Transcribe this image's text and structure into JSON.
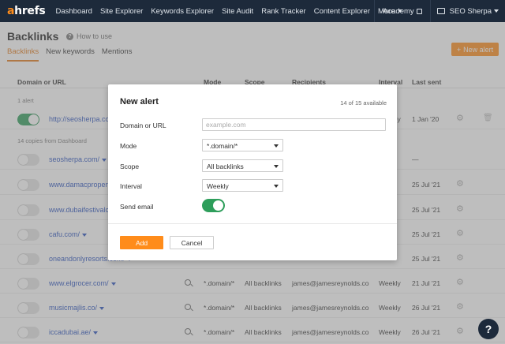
{
  "nav": {
    "logo_a": "a",
    "logo_rest": "hrefs",
    "items": [
      "Dashboard",
      "Site Explorer",
      "Keywords Explorer",
      "Site Audit",
      "Rank Tracker",
      "Content Explorer",
      "More"
    ],
    "academy": "Academy",
    "account": "SEO Sherpa"
  },
  "header": {
    "title": "Backlinks",
    "howto": "How to use",
    "tabs": [
      "Backlinks",
      "New keywords",
      "Mentions"
    ],
    "new_alert_button": "New alert"
  },
  "table": {
    "columns": {
      "domain": "Domain or URL",
      "mode": "Mode",
      "scope": "Scope",
      "recipients": "Recipients",
      "interval": "Interval",
      "last_sent": "Last sent"
    },
    "section1": "1 alert",
    "section2": "14 copies from Dashboard",
    "rows": [
      {
        "domain": "http://seosherpa.com",
        "mode": "",
        "scope": "",
        "recipients": "",
        "interval": "Weekly",
        "last_sent": "1 Jan '20",
        "enabled": true
      },
      {
        "domain": "seosherpa.com/",
        "mode": "",
        "scope": "",
        "recipients": "",
        "interval": "",
        "last_sent": "—",
        "enabled": false
      },
      {
        "domain": "www.damacproperties.com/",
        "mode": "",
        "scope": "",
        "recipients": "",
        "interval": "",
        "last_sent": "25 Jul '21",
        "enabled": false
      },
      {
        "domain": "www.dubaifestivalcity.com/",
        "mode": "",
        "scope": "",
        "recipients": "",
        "interval": "",
        "last_sent": "25 Jul '21",
        "enabled": false
      },
      {
        "domain": "cafu.com/",
        "mode": "",
        "scope": "",
        "recipients": "",
        "interval": "",
        "last_sent": "25 Jul '21",
        "enabled": false
      },
      {
        "domain": "oneandonlyresorts.com/",
        "mode": "",
        "scope": "",
        "recipients": "",
        "interval": "",
        "last_sent": "25 Jul '21",
        "enabled": false
      },
      {
        "domain": "www.elgrocer.com/",
        "mode": "*.domain/*",
        "scope": "All backlinks",
        "recipients": "james@jamesreynolds.co",
        "interval": "Weekly",
        "last_sent": "21 Jul '21",
        "enabled": false
      },
      {
        "domain": "musicmajlis.co/",
        "mode": "*.domain/*",
        "scope": "All backlinks",
        "recipients": "james@jamesreynolds.co",
        "interval": "Weekly",
        "last_sent": "26 Jul '21",
        "enabled": false
      },
      {
        "domain": "iccadubai.ae/",
        "mode": "*.domain/*",
        "scope": "All backlinks",
        "recipients": "james@jamesreynolds.co",
        "interval": "Weekly",
        "last_sent": "26 Jul '21",
        "enabled": false
      }
    ]
  },
  "modal": {
    "title": "New alert",
    "availability": "14 of 15 available",
    "domain_label": "Domain or URL",
    "domain_placeholder": "example.com",
    "mode_label": "Mode",
    "mode_value": "*.domain/*",
    "scope_label": "Scope",
    "scope_value": "All backlinks",
    "interval_label": "Interval",
    "interval_value": "Weekly",
    "send_email_label": "Send email",
    "send_email_on": true,
    "add_button": "Add",
    "cancel_button": "Cancel"
  },
  "help": "?",
  "colors": {
    "nav_bg": "#1d2a3b",
    "accent": "#ff8c1a",
    "toggle_on": "#2e9e5b",
    "link": "#2a52be"
  }
}
